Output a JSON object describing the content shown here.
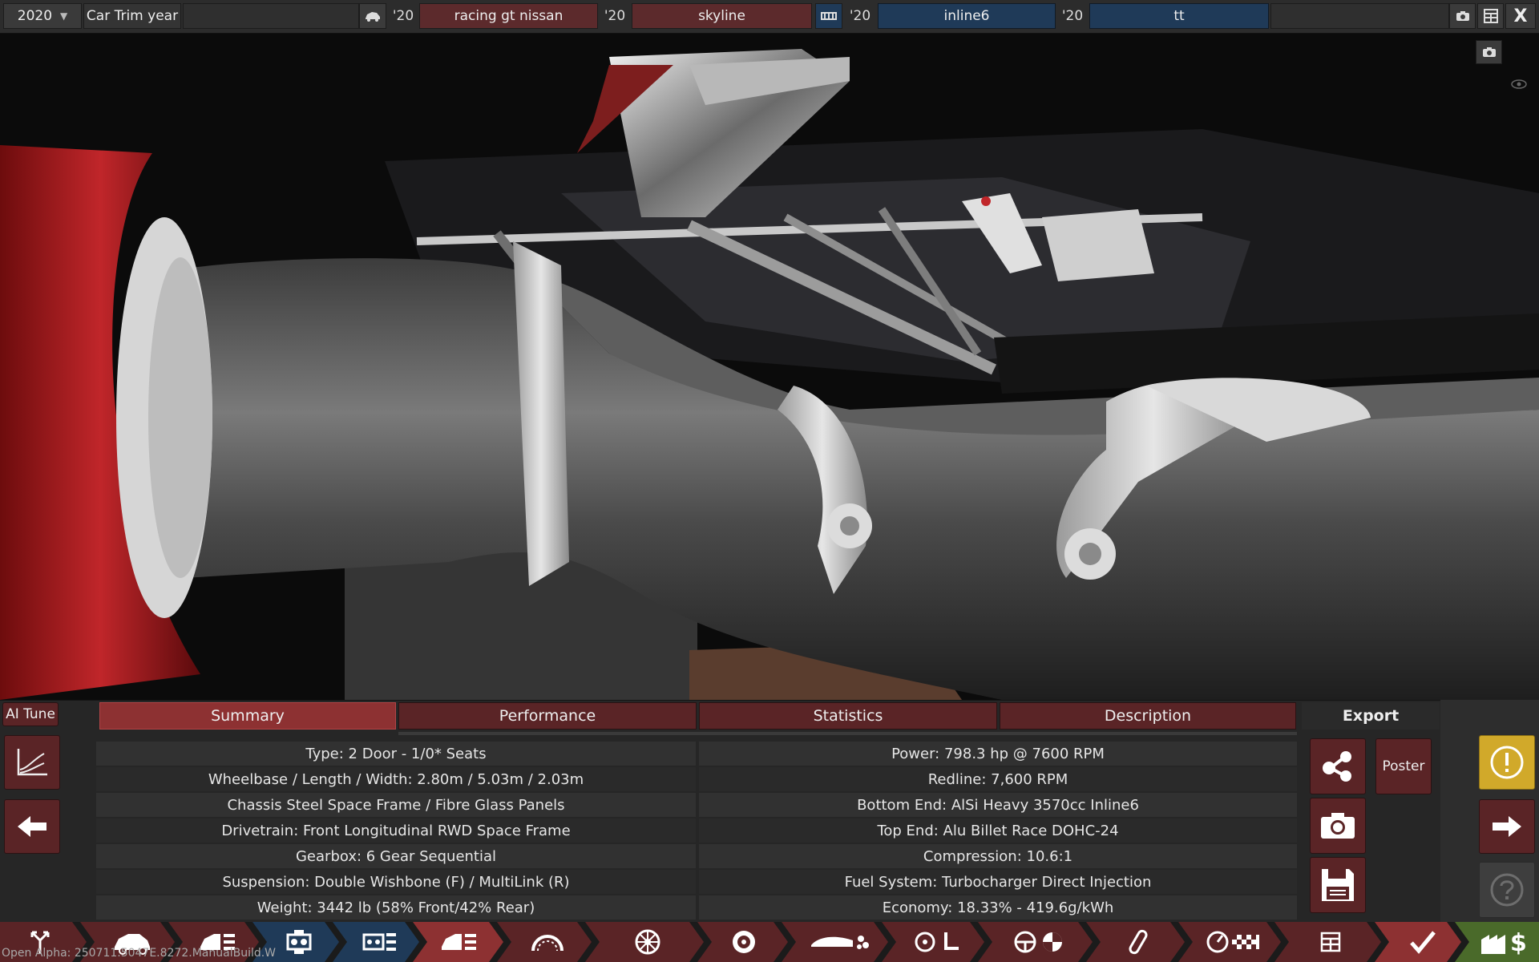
{
  "topbar": {
    "year": "2020",
    "year_arrow": "▼",
    "trim_year_label": "Car Trim year",
    "model_year_1": "'20",
    "model_name": "racing gt nissan",
    "model_year_2": "'20",
    "trim_name": "skyline",
    "engine_year_1": "'20",
    "engine_family": "inline6",
    "engine_year_2": "'20",
    "engine_variant": "tt",
    "close": "X"
  },
  "left": {
    "ai_tune": "AI Tune"
  },
  "tabs": [
    "Summary",
    "Performance",
    "Statistics",
    "Description"
  ],
  "summary": {
    "left": [
      "Type: 2 Door - 1/0* Seats",
      "Wheelbase / Length / Width: 2.80m / 5.03m / 2.03m",
      "Chassis Steel Space Frame / Fibre Glass Panels",
      "Drivetrain: Front Longitudinal RWD Space Frame",
      "Gearbox: 6 Gear Sequential",
      "Suspension: Double Wishbone (F) / MultiLink (R)",
      "Weight: 3442 lb (58% Front/42% Rear)"
    ],
    "right": [
      "Power: 798.3 hp @ 7600 RPM",
      "Redline:  7,600 RPM",
      "Bottom End: AlSi Heavy 3570cc Inline6",
      "Top End: Alu Billet Race DOHC-24",
      "Compression: 10.6:1",
      "Fuel System: Turbocharger Direct Injection",
      "Economy: 18.33% - 419.6g/kWh"
    ]
  },
  "export": {
    "title": "Export",
    "poster": "Poster"
  },
  "icons": {
    "graph": "graph-icon",
    "back": "arrow-left-icon",
    "next": "arrow-right-icon",
    "warning": "warning-icon",
    "help": "help-icon",
    "share": "share-icon",
    "camera": "camera-icon",
    "save": "save-icon"
  },
  "colors": {
    "accent_red": "#8d3132",
    "tab_red": "#5a2426",
    "blue": "#1f3a58",
    "warning": "#d1a92a"
  },
  "version": "Open Alpha: 250711.5047E.8272.ManualBuild.W"
}
